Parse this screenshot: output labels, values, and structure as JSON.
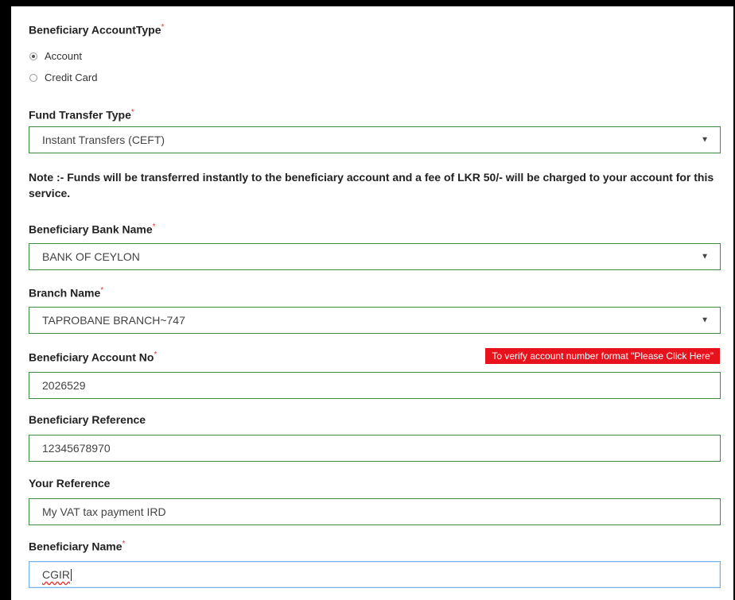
{
  "account_type": {
    "label": "Beneficiary AccountType",
    "required_mark": "*",
    "options": [
      {
        "label": "Account",
        "selected": true
      },
      {
        "label": "Credit Card",
        "selected": false
      }
    ]
  },
  "fund_transfer_type": {
    "label": "Fund Transfer Type",
    "required_mark": "*",
    "value": "Instant Transfers (CEFT)",
    "arrow": "▼"
  },
  "note": "Note :- Funds will be transferred instantly to the beneficiary account and a fee of LKR 50/- will be charged to your account for this service.",
  "bank_name": {
    "label": "Beneficiary Bank Name",
    "required_mark": "*",
    "value": "BANK OF CEYLON",
    "arrow": "▼"
  },
  "branch_name": {
    "label": "Branch Name",
    "required_mark": "*",
    "value": "TAPROBANE BRANCH~747",
    "arrow": "▼"
  },
  "account_no": {
    "label": "Beneficiary Account No",
    "required_mark": "*",
    "value": "2026529",
    "verify_button": "To verify account number format \"Please Click Here\""
  },
  "beneficiary_reference": {
    "label": "Beneficiary Reference",
    "value": "12345678970"
  },
  "your_reference": {
    "label": "Your Reference",
    "value": "My VAT tax payment IRD"
  },
  "beneficiary_name": {
    "label": "Beneficiary Name",
    "required_mark": "*",
    "value": "CGIR"
  },
  "colors": {
    "field_border": "#3d8b3d",
    "required": "#e53935",
    "verify_button_bg": "#e8121c",
    "focus_border": "#7ab3e6"
  }
}
